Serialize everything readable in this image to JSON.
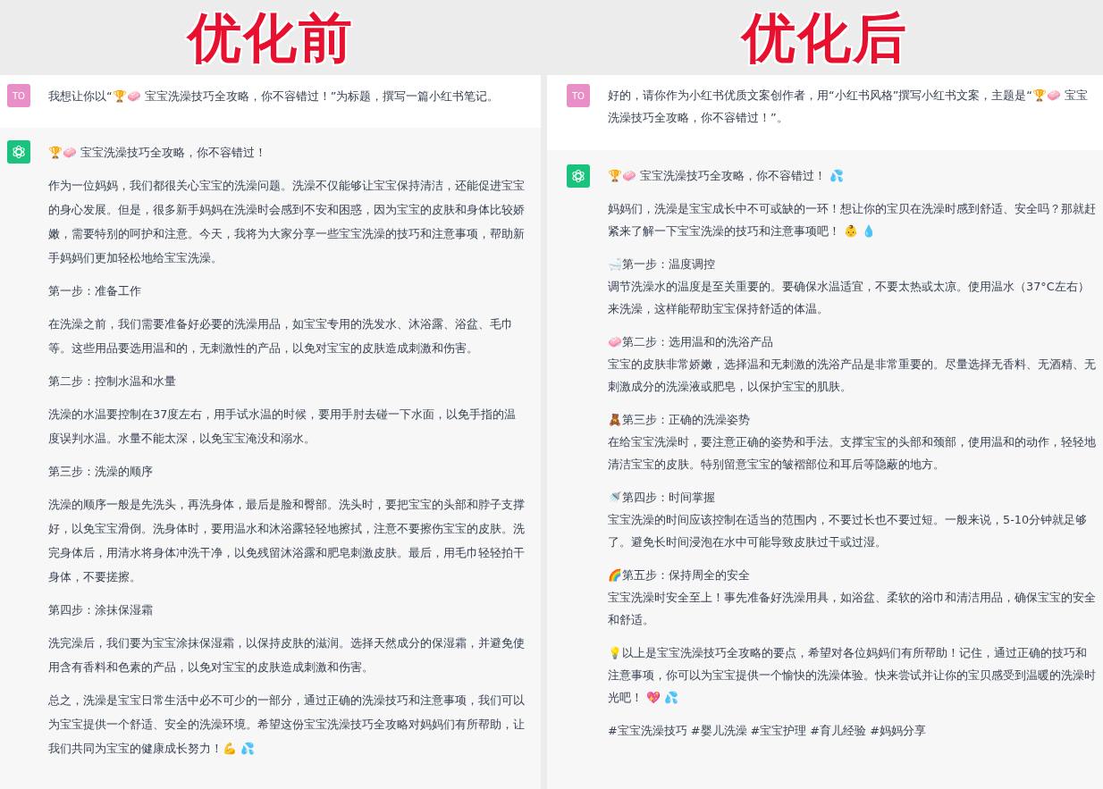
{
  "panels": [
    {
      "heading": "优化前",
      "user": {
        "avatar": "TO",
        "text": "我想让你以“🏆🧼 宝宝洗澡技巧全攻略，你不容错过！”为标题，撰写一篇小红书笔记。"
      },
      "assistant": {
        "blocks": [
          {
            "text": "🏆🧼 宝宝洗澡技巧全攻略，你不容错过！"
          },
          {
            "text": "作为一位妈妈，我们都很关心宝宝的洗澡问题。洗澡不仅能够让宝宝保持清洁，还能促进宝宝的身心发展。但是，很多新手妈妈在洗澡时会感到不安和困惑，因为宝宝的皮肤和身体比较娇嫩，需要特别的呵护和注意。今天，我将为大家分享一些宝宝洗澡的技巧和注意事项，帮助新手妈妈们更加轻松地给宝宝洗澡。"
          },
          {
            "text": "第一步：准备工作"
          },
          {
            "text": "在洗澡之前，我们需要准备好必要的洗澡用品，如宝宝专用的洗发水、沐浴露、浴盆、毛巾等。这些用品要选用温和的，无刺激性的产品，以免对宝宝的皮肤造成刺激和伤害。"
          },
          {
            "text": "第二步：控制水温和水量"
          },
          {
            "text": "洗澡的水温要控制在37度左右，用手试水温的时候，要用手肘去碰一下水面，以免手指的温度误判水温。水量不能太深，以免宝宝淹没和溺水。"
          },
          {
            "text": "第三步：洗澡的顺序"
          },
          {
            "text": "洗澡的顺序一般是先洗头，再洗身体，最后是脸和臀部。洗头时，要把宝宝的头部和脖子支撑好，以免宝宝滑倒。洗身体时，要用温水和沐浴露轻轻地擦拭，注意不要擦伤宝宝的皮肤。洗完身体后，用清水将身体冲洗干净，以免残留沐浴露和肥皂刺激皮肤。最后，用毛巾轻轻拍干身体，不要搓擦。"
          },
          {
            "text": "第四步：涂抹保湿霜"
          },
          {
            "text": "洗完澡后，我们要为宝宝涂抹保湿霜，以保持皮肤的滋润。选择天然成分的保湿霜，并避免使用含有香料和色素的产品，以免对宝宝的皮肤造成刺激和伤害。"
          },
          {
            "text": "总之，洗澡是宝宝日常生活中必不可少的一部分，通过正确的洗澡技巧和注意事项，我们可以为宝宝提供一个舒适、安全的洗澡环境。希望这份宝宝洗澡技巧全攻略对妈妈们有所帮助，让我们共同为宝宝的健康成长努力！💪 💦"
          }
        ]
      }
    },
    {
      "heading": "优化后",
      "user": {
        "avatar": "TO",
        "text": "好的，请你作为小红书优质文案创作者，用“小红书风格”撰写小红书文案，主题是“🏆🧼 宝宝洗澡技巧全攻略，你不容错过！”。"
      },
      "assistant": {
        "blocks": [
          {
            "text": "🏆🧼 宝宝洗澡技巧全攻略，你不容错过！ 💦"
          },
          {
            "text": "妈妈们，洗澡是宝宝成长中不可或缺的一环！想让你的宝贝在洗澡时感到舒适、安全吗？那就赶紧来了解一下宝宝洗澡的技巧和注意事项吧！ 👶 💧"
          },
          {
            "text": "🛁第一步：温度调控",
            "body": "调节洗澡水的温度是至关重要的。要确保水温适宜，不要太热或太凉。使用温水（37°C左右）来洗澡，这样能帮助宝宝保持舒适的体温。"
          },
          {
            "text": "🧼第二步：选用温和的洗浴产品",
            "body": "宝宝的皮肤非常娇嫩，选择温和无刺激的洗浴产品是非常重要的。尽量选择无香料、无酒精、无刺激成分的洗澡液或肥皂，以保护宝宝的肌肤。"
          },
          {
            "text": "🧸第三步：正确的洗澡姿势",
            "body": "在给宝宝洗澡时，要注意正确的姿势和手法。支撑宝宝的头部和颈部，使用温和的动作，轻轻地清洁宝宝的皮肤。特别留意宝宝的皱褶部位和耳后等隐蔽的地方。"
          },
          {
            "text": "🚿第四步：时间掌握",
            "body": "宝宝洗澡的时间应该控制在适当的范围内，不要过长也不要过短。一般来说，5-10分钟就足够了。避免长时间浸泡在水中可能导致皮肤过干或过湿。"
          },
          {
            "text": "🌈第五步：保持周全的安全",
            "body": "宝宝洗澡时安全至上！事先准备好洗澡用具，如浴盆、柔软的浴巾和清洁用品，确保宝宝的安全和舒适。"
          },
          {
            "text": "💡以上是宝宝洗澡技巧全攻略的要点，希望对各位妈妈们有所帮助！记住，通过正确的技巧和注意事项，你可以为宝宝提供一个愉快的洗澡体验。快来尝试并让你的宝贝感受到温暖的洗澡时光吧！ 💖 💦"
          },
          {
            "text": "#宝宝洗澡技巧 #婴儿洗澡 #宝宝护理 #育儿经验 #妈妈分享"
          }
        ]
      }
    }
  ]
}
